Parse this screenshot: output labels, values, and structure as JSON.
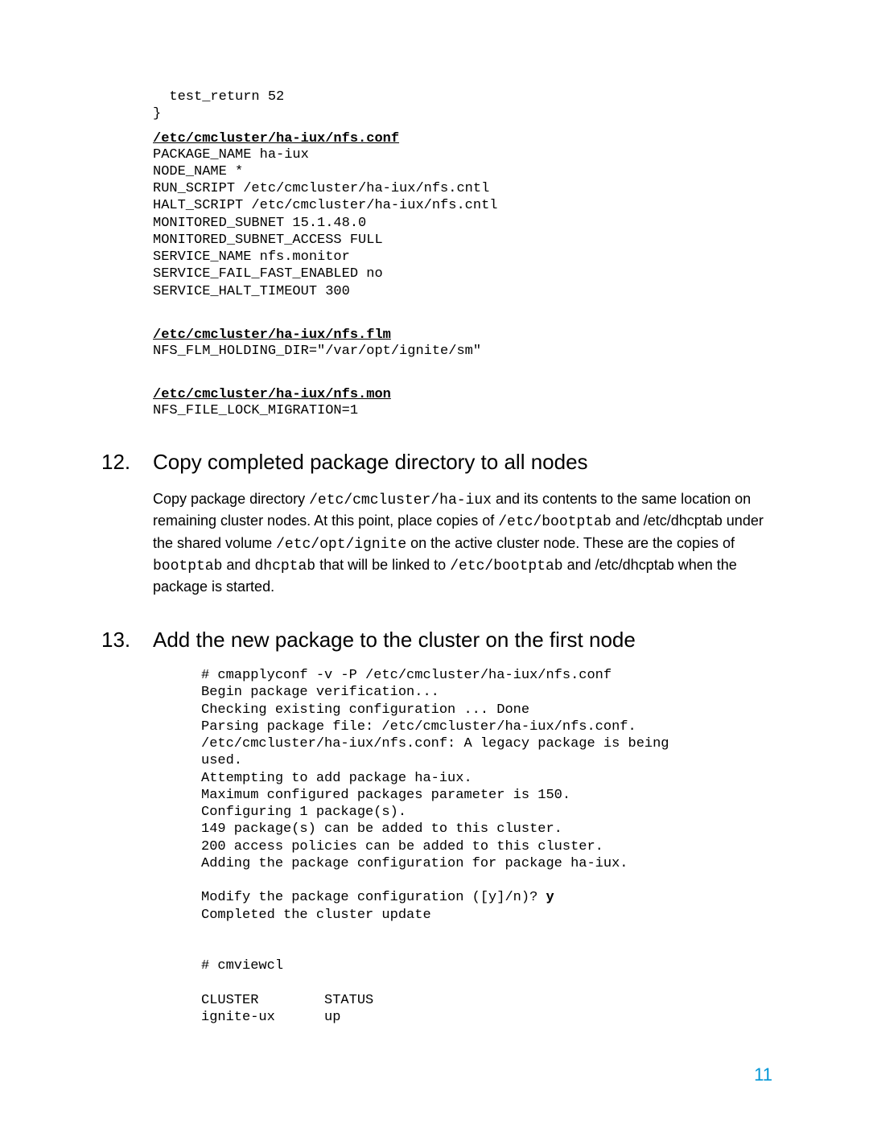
{
  "top_code": "  test_return 52\n}",
  "file1": {
    "header": "/etc/cmcluster/ha-iux/nfs.conf",
    "body": "PACKAGE_NAME ha-iux\nNODE_NAME *\nRUN_SCRIPT /etc/cmcluster/ha-iux/nfs.cntl\nHALT_SCRIPT /etc/cmcluster/ha-iux/nfs.cntl\nMONITORED_SUBNET 15.1.48.0\nMONITORED_SUBNET_ACCESS FULL\nSERVICE_NAME nfs.monitor\nSERVICE_FAIL_FAST_ENABLED no\nSERVICE_HALT_TIMEOUT 300"
  },
  "file2": {
    "header": "/etc/cmcluster/ha-iux/nfs.flm",
    "body": "NFS_FLM_HOLDING_DIR=\"/var/opt/ignite/sm\""
  },
  "file3": {
    "header": "/etc/cmcluster/ha-iux/nfs.mon",
    "body": "NFS_FILE_LOCK_MIGRATION=1"
  },
  "section12": {
    "num": "12.",
    "title": "Copy completed package directory to all nodes",
    "p1a": "Copy package directory ",
    "p1b": "/etc/cmcluster/ha-iux",
    "p1c": " and its contents to the same location on remaining cluster nodes. At this point, place copies of ",
    "p1d": "/etc/bootptab",
    "p1e": " and /etc/dhcptab under the shared volume ",
    "p1f": "/etc/opt/ignite",
    "p1g": " on the active cluster node. These are the copies of ",
    "p1h": "bootptab",
    "p1i": " and ",
    "p1j": "dhcptab",
    "p1k": " that will be linked to ",
    "p1l": "/etc/bootptab",
    "p1m": " and  /etc/dhcptab when the package is started."
  },
  "section13": {
    "num": "13.",
    "title": "Add the new package to the cluster on the first node",
    "cmd_block_pre": "# cmapplyconf -v -P /etc/cmcluster/ha-iux/nfs.conf\nBegin package verification...\nChecking existing configuration ... Done\nParsing package file: /etc/cmcluster/ha-iux/nfs.conf.\n/etc/cmcluster/ha-iux/nfs.conf: A legacy package is being\nused.\nAttempting to add package ha-iux.\nMaximum configured packages parameter is 150.\nConfiguring 1 package(s).\n149 package(s) can be added to this cluster.\n200 access policies can be added to this cluster.\nAdding the package configuration for package ha-iux.\n\nModify the package configuration ([y]/n)? ",
    "cmd_bold": "y",
    "cmd_block_post": "\nCompleted the cluster update\n\n\n# cmviewcl\n\nCLUSTER        STATUS\nignite-ux      up"
  },
  "page_number": "11"
}
